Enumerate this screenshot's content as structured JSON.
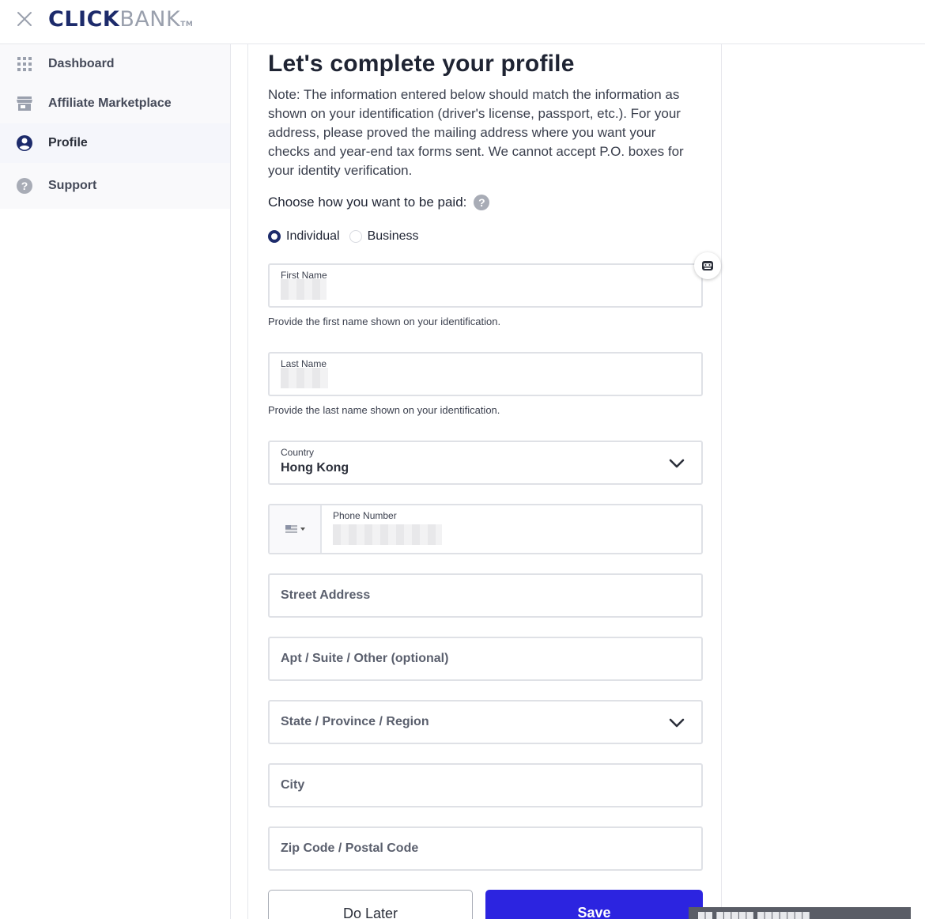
{
  "header": {
    "logo_click": "CLICK",
    "logo_bank": "BANK",
    "logo_tm": "TM"
  },
  "sidebar": {
    "items": [
      {
        "label": "Dashboard",
        "icon": "grid-icon"
      },
      {
        "label": "Affiliate Marketplace",
        "icon": "store-icon"
      },
      {
        "label": "Profile",
        "icon": "user-circle-icon",
        "active": true
      },
      {
        "label": "Support",
        "icon": "help-circle-icon"
      }
    ]
  },
  "main": {
    "title": "Let's complete your profile",
    "note": "Note: The information entered below should match the information as shown on your identification (driver's license, passport, etc.). For your address, please proved the mailing address where you want your checks and year-end tax forms sent. We cannot accept P.O. boxes for your identity verification.",
    "pay_label": "Choose how you want to be paid:",
    "pay_options": [
      {
        "label": "Individual",
        "selected": true
      },
      {
        "label": "Business",
        "selected": false
      }
    ],
    "first_name": {
      "label": "First Name",
      "hint": "Provide the first name shown on your identification."
    },
    "last_name": {
      "label": "Last Name",
      "hint": "Provide the last name shown on your identification."
    },
    "country": {
      "label": "Country",
      "value": "Hong Kong"
    },
    "phone": {
      "label": "Phone Number"
    },
    "street_address": {
      "placeholder": "Street Address"
    },
    "apt": {
      "placeholder": "Apt / Suite / Other (optional)"
    },
    "state": {
      "placeholder": "State / Province / Region"
    },
    "city": {
      "placeholder": "City"
    },
    "zip": {
      "placeholder": "Zip Code / Postal Code"
    },
    "buttons": {
      "later": "Do Later",
      "save": "Save"
    }
  },
  "colors": {
    "brand_navy": "#1d2b6b",
    "save_button": "#2c24e0"
  }
}
